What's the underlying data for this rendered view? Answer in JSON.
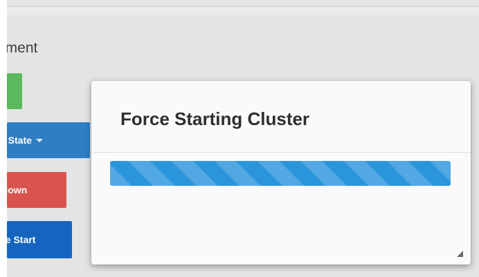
{
  "page": {
    "header_text": "pment"
  },
  "buttons": {
    "change_state": {
      "label": "e State",
      "color": "#2f7ec4"
    },
    "shutdown": {
      "label": "tdown",
      "color": "#d9534f"
    },
    "force_start": {
      "label": "ce Start",
      "color": "#1565c0"
    },
    "green": {
      "label": "",
      "color": "#5cb85c"
    }
  },
  "modal": {
    "title": "Force Starting Cluster",
    "progress": {
      "value": 1.0,
      "style": "striped-animated",
      "color": "#2b95dc"
    }
  }
}
